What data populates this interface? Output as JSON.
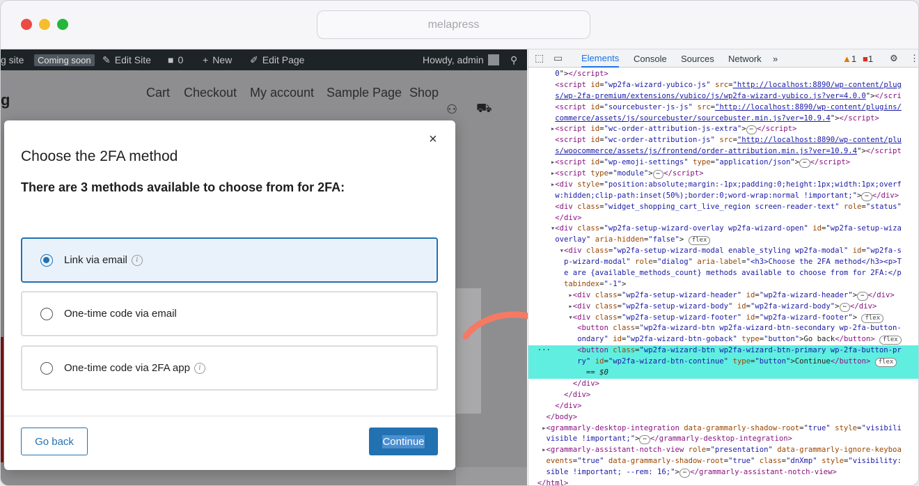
{
  "browser": {
    "url_text": "melapress"
  },
  "admin_bar": {
    "site": "g site",
    "coming_soon": "Coming soon",
    "edit_site": "Edit Site",
    "comments_count": "0",
    "new": "New",
    "edit_page": "Edit Page",
    "howdy": "Howdy, admin"
  },
  "site_nav": {
    "logo": "g",
    "items": [
      "Cart",
      "Checkout",
      "My account",
      "Sample Page",
      "Shop"
    ]
  },
  "modal": {
    "title": "Choose the 2FA method",
    "subtitle": "There are 3 methods available to choose from for 2FA:",
    "options": [
      {
        "label": "Link via email",
        "selected": true,
        "info": true
      },
      {
        "label": "One-time code via email",
        "selected": false,
        "info": false
      },
      {
        "label": "One-time code via 2FA app",
        "selected": false,
        "info": true
      }
    ],
    "back_label": "Go back",
    "continue_label": "Continue",
    "close_glyph": "×"
  },
  "devtools": {
    "tabs": [
      "Elements",
      "Console",
      "Sources",
      "Network"
    ],
    "more": "»",
    "warnings": "1",
    "errors": "1"
  },
  "colors": {
    "accent": "#2271b1",
    "selected_bg": "#e9f2fa",
    "highlight": "#5feee0",
    "arrow": "#f47a64"
  }
}
